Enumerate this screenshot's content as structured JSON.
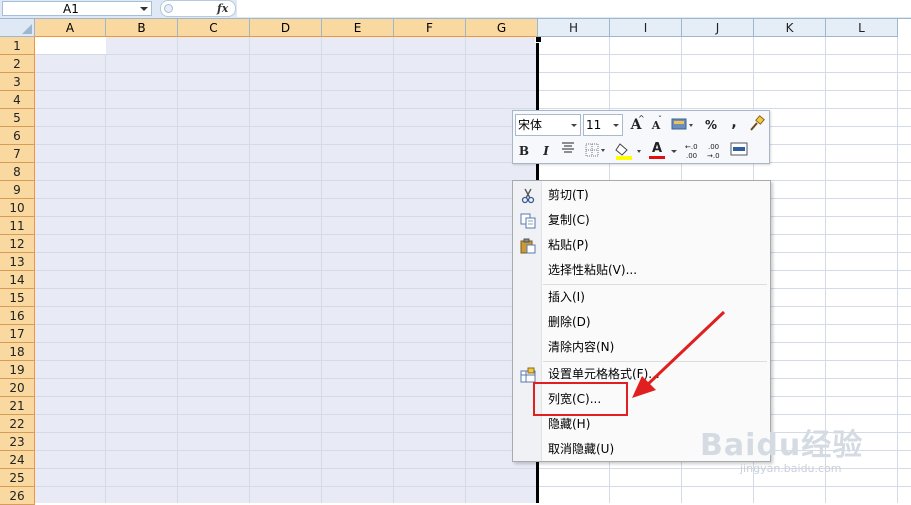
{
  "formula_bar": {
    "name_box": "A1",
    "fx_label": "fx",
    "formula": ""
  },
  "columns": [
    "A",
    "B",
    "C",
    "D",
    "E",
    "F",
    "G",
    "H",
    "I",
    "J",
    "K",
    "L"
  ],
  "selected_columns": [
    "A",
    "B",
    "C",
    "D",
    "E",
    "F",
    "G"
  ],
  "rows": [
    "1",
    "2",
    "3",
    "4",
    "5",
    "6",
    "7",
    "8",
    "9",
    "10",
    "11",
    "12",
    "13",
    "14",
    "15",
    "16",
    "17",
    "18",
    "19",
    "20",
    "21",
    "22",
    "23",
    "24",
    "25",
    "26"
  ],
  "mini_toolbar": {
    "font_name": "宋体",
    "font_size": "11",
    "grow_font": "A",
    "shrink_font": "A",
    "percent": "%",
    "comma": ",",
    "bold": "B",
    "italic": "I",
    "font_color_label": "A",
    "increase_decimal": "+.0\n.00",
    "decrease_decimal": ".00\n+.0",
    "increase_decimal_text": ".00",
    "decrease_decimal_text": ".00"
  },
  "context_menu": {
    "items": [
      {
        "label": "剪切(T)",
        "icon": "scissors-icon"
      },
      {
        "label": "复制(C)",
        "icon": "copy-icon"
      },
      {
        "label": "粘贴(P)",
        "icon": "paste-icon"
      },
      {
        "label": "选择性粘贴(V)...",
        "icon": ""
      },
      {
        "label": "插入(I)",
        "icon": ""
      },
      {
        "label": "删除(D)",
        "icon": ""
      },
      {
        "label": "清除内容(N)",
        "icon": ""
      },
      {
        "label": "设置单元格格式(F)...",
        "icon": "format-cells-icon"
      },
      {
        "label": "列宽(C)...",
        "icon": ""
      },
      {
        "label": "隐藏(H)",
        "icon": ""
      },
      {
        "label": "取消隐藏(U)",
        "icon": ""
      }
    ]
  },
  "watermark": {
    "brand": "Baidu经验",
    "url": "jingyan.baidu.com"
  },
  "colors": {
    "selection_fill": "#e8eaf5",
    "header_selected": "#f9d99f",
    "annotation_red": "#e02020"
  }
}
